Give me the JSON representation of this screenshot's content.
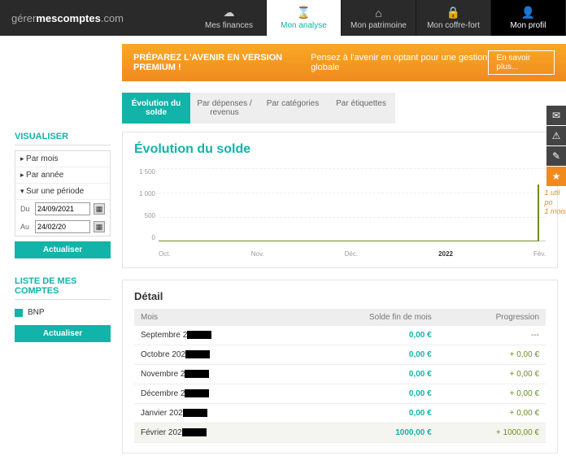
{
  "brand": {
    "pre": "gérer",
    "bold": "mescomptes",
    "suf": ".com"
  },
  "nav": [
    {
      "label": "Mes finances",
      "ico": "☁"
    },
    {
      "label": "Mon analyse",
      "ico": "⌛",
      "active": true
    },
    {
      "label": "Mon patrimoine",
      "ico": "⌂"
    },
    {
      "label": "Mon coffre-fort",
      "ico": "🔒"
    },
    {
      "label": "Mon profil",
      "ico": "👤",
      "profile": true
    }
  ],
  "promo": {
    "bold": "PRÉPAREZ L'AVENIR EN VERSION PREMIUM !",
    "text": "Pensez à l'avenir en optant pour une gestion globale",
    "btn": "En savoir plus..."
  },
  "tabs": [
    {
      "label": "Évolution du solde",
      "active": true
    },
    {
      "label": "Par dépenses / revenus"
    },
    {
      "label": "Par catégories"
    },
    {
      "label": "Par étiquettes"
    }
  ],
  "side": {
    "visu_title": "VISUALISER",
    "rows": [
      "Par mois",
      "Par année",
      "Sur une période"
    ],
    "du": "Du",
    "du_val": "24/09/2021",
    "au": "Au",
    "au_val": "24/02/20",
    "update": "Actualiser",
    "accts_title": "LISTE DE MES COMPTES",
    "acct": "BNP"
  },
  "chart_title": "Évolution du solde",
  "chart_data": {
    "type": "line",
    "title": "Évolution du solde",
    "xlabel": "",
    "ylabel": "",
    "ylim": [
      0,
      1500
    ],
    "yticks": [
      0,
      500,
      1000,
      1500
    ],
    "x": [
      "Oct.",
      "Nov.",
      "Déc.",
      "2022",
      "Fév."
    ],
    "values": [
      0,
      0,
      0,
      0,
      1000
    ]
  },
  "detail": {
    "title": "Détail",
    "headers": {
      "m": "Mois",
      "s": "Solde fin de mois",
      "p": "Progression"
    },
    "rows": [
      {
        "m": "Septembre 2",
        "s": "0,00 €",
        "p": "---"
      },
      {
        "m": "Octobre 202",
        "s": "0,00 €",
        "p": "+ 0,00 €"
      },
      {
        "m": "Novembre 2",
        "s": "0,00 €",
        "p": "+ 0,00 €"
      },
      {
        "m": "Décembre 2",
        "s": "0,00 €",
        "p": "+ 0,00 €"
      },
      {
        "m": "Janvier 202",
        "s": "0,00 €",
        "p": "+ 0,00 €"
      },
      {
        "m": "Février 202",
        "s": "1000,00 €",
        "p": "+ 1000,00 €",
        "hl": true
      }
    ]
  },
  "hand": {
    "l1": "1 util",
    "l2": "po",
    "l3": "1 mois"
  }
}
